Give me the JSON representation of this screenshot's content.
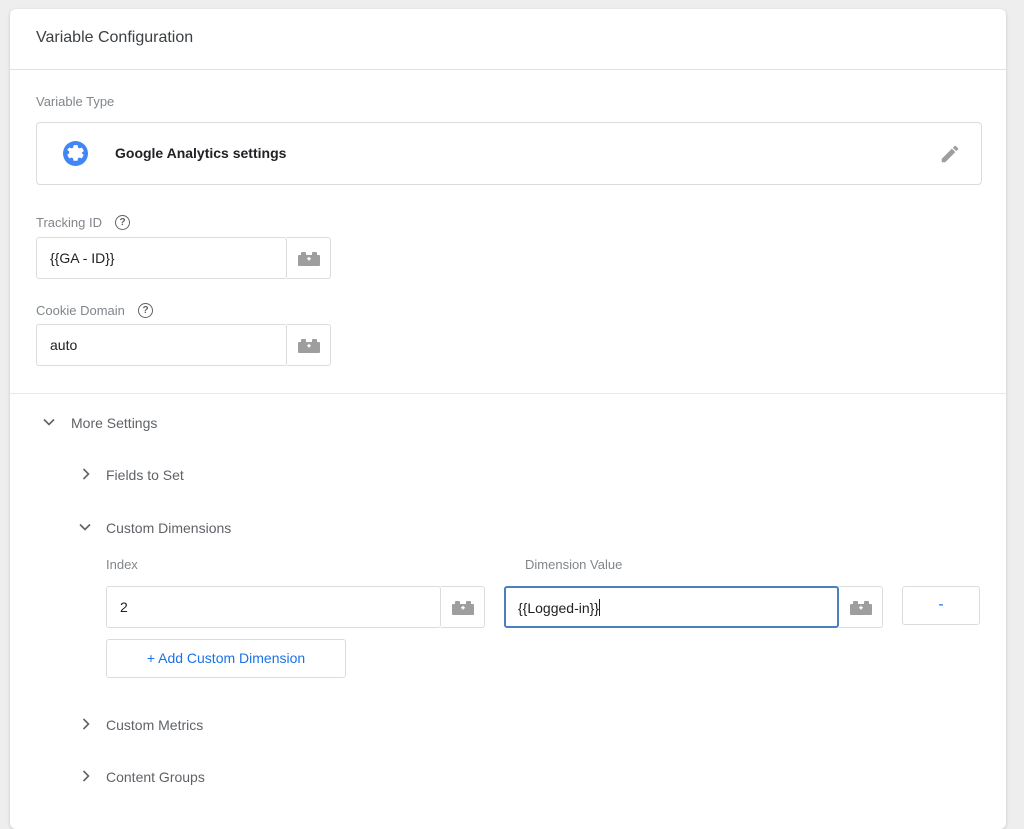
{
  "header": {
    "title": "Variable Configuration"
  },
  "variable_type": {
    "label": "Variable Type",
    "name": "Google Analytics settings",
    "icon": "gear-icon",
    "edit_icon": "pencil-icon",
    "accent": "#4285f4"
  },
  "tracking_id": {
    "label": "Tracking ID",
    "help": "?",
    "value": "{{GA - ID}}"
  },
  "cookie_domain": {
    "label": "Cookie Domain",
    "help": "?",
    "value": "auto"
  },
  "more_settings": {
    "label": "More Settings",
    "expanded": true,
    "sections": {
      "fields_to_set": {
        "label": "Fields to Set",
        "expanded": false
      },
      "custom_dimensions": {
        "label": "Custom Dimensions",
        "expanded": true,
        "index_label": "Index",
        "value_label": "Dimension Value",
        "rows": [
          {
            "index": "2",
            "value": "{{Logged-in}}"
          }
        ],
        "remove_label": "-",
        "add_label": "+ Add Custom Dimension"
      },
      "custom_metrics": {
        "label": "Custom Metrics",
        "expanded": false
      },
      "content_groups": {
        "label": "Content Groups",
        "expanded": false
      }
    }
  },
  "colors": {
    "link": "#1a73e8",
    "focus_border": "#4a7fc1",
    "icon_gray": "#9e9e9e"
  }
}
